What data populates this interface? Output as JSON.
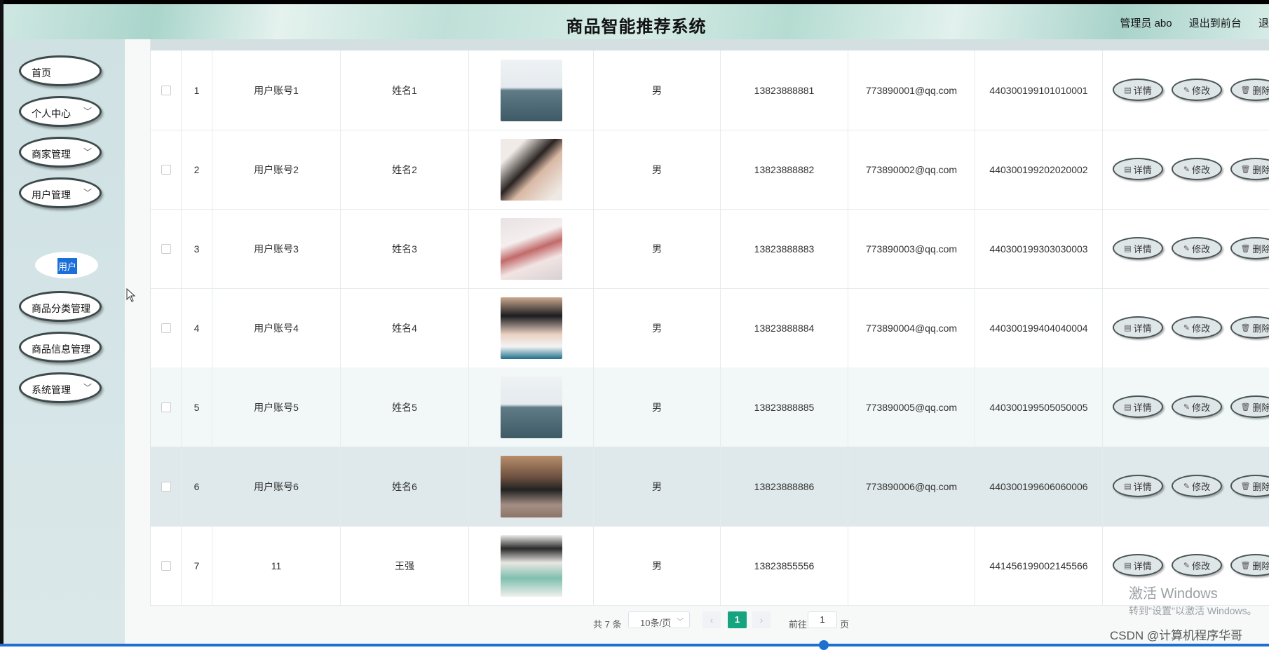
{
  "header": {
    "title": "商品智能推荐系统",
    "admin": "管理员 abo",
    "frontend": "退出到前台",
    "logout": "退"
  },
  "sidebar": {
    "items": [
      {
        "label": "首页",
        "chevron": false
      },
      {
        "label": "个人中心",
        "chevron": true
      },
      {
        "label": "商家管理",
        "chevron": true
      },
      {
        "label": "用户管理",
        "chevron": true
      },
      {
        "label": "商品分类管理",
        "chevron": true
      },
      {
        "label": "商品信息管理",
        "chevron": true
      },
      {
        "label": "系统管理",
        "chevron": true
      }
    ],
    "submenu_label": "用户"
  },
  "table": {
    "rows": [
      {
        "index": "1",
        "account": "用户账号1",
        "name": "姓名1",
        "gender": "男",
        "phone": "13823888881",
        "email": "773890001@qq.com",
        "idcard": "440300199101010001"
      },
      {
        "index": "2",
        "account": "用户账号2",
        "name": "姓名2",
        "gender": "男",
        "phone": "13823888882",
        "email": "773890002@qq.com",
        "idcard": "440300199202020002"
      },
      {
        "index": "3",
        "account": "用户账号3",
        "name": "姓名3",
        "gender": "男",
        "phone": "13823888883",
        "email": "773890003@qq.com",
        "idcard": "440300199303030003"
      },
      {
        "index": "4",
        "account": "用户账号4",
        "name": "姓名4",
        "gender": "男",
        "phone": "13823888884",
        "email": "773890004@qq.com",
        "idcard": "440300199404040004"
      },
      {
        "index": "5",
        "account": "用户账号5",
        "name": "姓名5",
        "gender": "男",
        "phone": "13823888885",
        "email": "773890005@qq.com",
        "idcard": "440300199505050005"
      },
      {
        "index": "6",
        "account": "用户账号6",
        "name": "姓名6",
        "gender": "男",
        "phone": "13823888886",
        "email": "773890006@qq.com",
        "idcard": "440300199606060006"
      },
      {
        "index": "7",
        "account": "11",
        "name": "王强",
        "gender": "男",
        "phone": "13823855556",
        "email": "",
        "idcard": "441456199002145566"
      }
    ],
    "actions": {
      "detail": "详情",
      "edit": "修改",
      "delete": "删除"
    }
  },
  "pagination": {
    "total": "共 7 条",
    "page_size": "10条/页",
    "current_page": "1",
    "goto_label": "前往",
    "goto_value": "1",
    "page_unit": "页"
  },
  "watermark": {
    "line1": "激活 Windows",
    "line2": "转到\"设置\"以激活 Windows。"
  },
  "credit": "CSDN @计算机程序华哥",
  "colors": {
    "accent": "#16a37f",
    "selected": "#1a6fd9",
    "highlight_row": "#f2f8f8",
    "selected_row": "#dfe8ea"
  }
}
